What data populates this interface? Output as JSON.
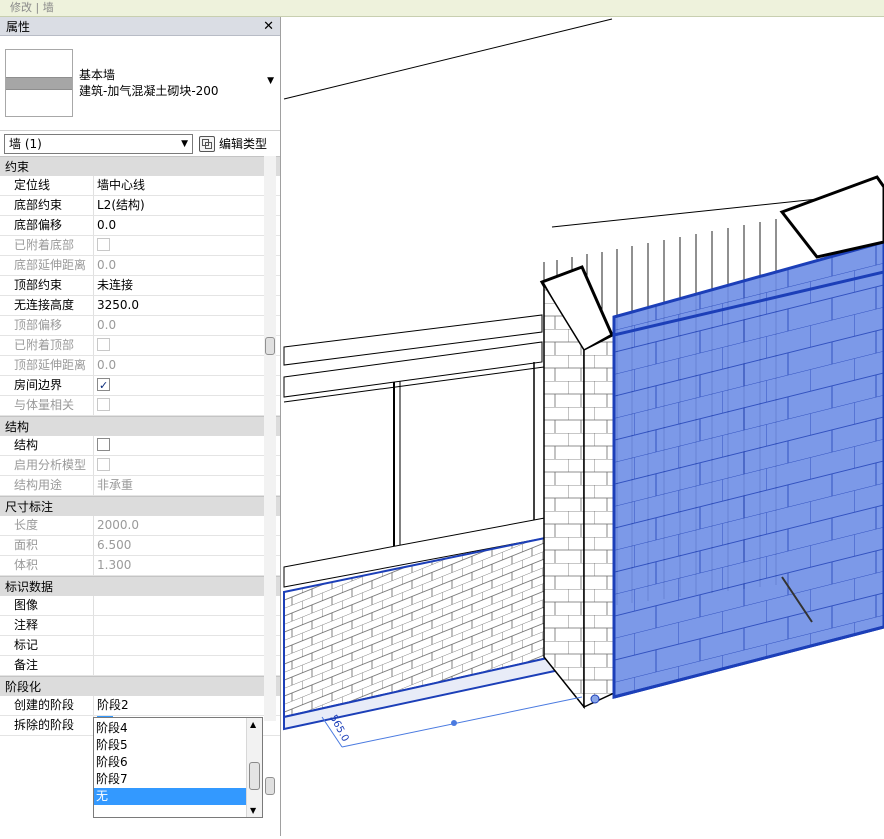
{
  "breadcrumb": "修改 | 墙",
  "panel": {
    "title": "属性",
    "close_icon": "close-icon",
    "type_family": "基本墙",
    "type_name": "建筑-加气混凝土砌块-200",
    "instance_filter": "墙 (1)",
    "edit_type_label": "编辑类型"
  },
  "groups": {
    "constraints": "约束",
    "structure": "结构",
    "dimensions": "尺寸标注",
    "identity": "标识数据",
    "phasing": "阶段化"
  },
  "constraints": {
    "location_line_k": "定位线",
    "location_line_v": "墙中心线",
    "base_constraint_k": "底部约束",
    "base_constraint_v": "L2(结构)",
    "base_offset_k": "底部偏移",
    "base_offset_v": "0.0",
    "base_attached_k": "已附着底部",
    "base_extension_k": "底部延伸距离",
    "base_extension_v": "0.0",
    "top_constraint_k": "顶部约束",
    "top_constraint_v": "未连接",
    "unconnected_height_k": "无连接高度",
    "unconnected_height_v": "3250.0",
    "top_offset_k": "顶部偏移",
    "top_offset_v": "0.0",
    "top_attached_k": "已附着顶部",
    "top_extension_k": "顶部延伸距离",
    "top_extension_v": "0.0",
    "room_bounding_k": "房间边界",
    "room_bounding_checked": true,
    "related_mass_k": "与体量相关"
  },
  "structure": {
    "structural_k": "结构",
    "analytical_k": "启用分析模型",
    "usage_k": "结构用途",
    "usage_v": "非承重"
  },
  "dimensions": {
    "length_k": "长度",
    "length_v": "2000.0",
    "area_k": "面积",
    "area_v": "6.500",
    "volume_k": "体积",
    "volume_v": "1.300"
  },
  "identity": {
    "image_k": "图像",
    "comments_k": "注释",
    "mark_k": "标记",
    "notes_k": "备注"
  },
  "phasing": {
    "created_k": "创建的阶段",
    "created_v": "阶段2",
    "demolished_k": "拆除的阶段",
    "demolished_v": "无",
    "options": [
      "阶段4",
      "阶段5",
      "阶段6",
      "阶段7",
      "无"
    ],
    "selected_option": "无"
  },
  "viewport": {
    "dimension_text": "565.0",
    "selection_color": "#3a66d8"
  }
}
